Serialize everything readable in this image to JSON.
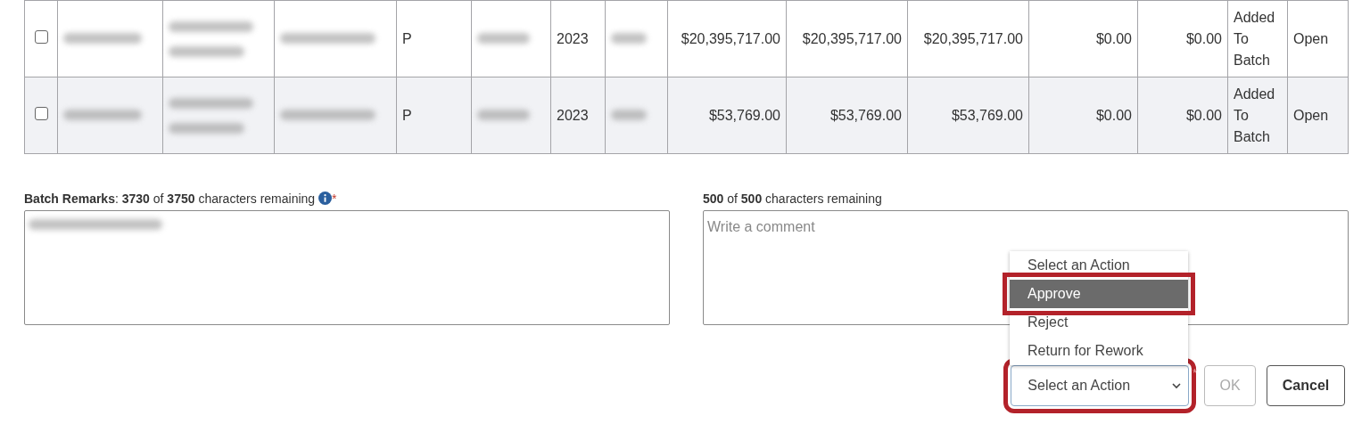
{
  "table": {
    "rows": [
      {
        "checked": false,
        "selected": false,
        "cells": [
          {
            "kind": "redacted"
          },
          {
            "kind": "redacted-wrapped"
          },
          {
            "kind": "redacted"
          },
          {
            "kind": "text",
            "text": "P"
          },
          {
            "kind": "redacted"
          },
          {
            "kind": "text",
            "text": "2023"
          },
          {
            "kind": "redacted"
          },
          {
            "kind": "money",
            "text": "$20,395,717.00"
          },
          {
            "kind": "money",
            "text": "$20,395,717.00"
          },
          {
            "kind": "money",
            "text": "$20,395,717.00"
          },
          {
            "kind": "money",
            "text": "$0.00"
          },
          {
            "kind": "money",
            "text": "$0.00"
          },
          {
            "kind": "text",
            "text": "Added To Batch"
          },
          {
            "kind": "text",
            "text": "Open"
          }
        ]
      },
      {
        "checked": false,
        "selected": true,
        "cells": [
          {
            "kind": "redacted"
          },
          {
            "kind": "redacted-wrapped"
          },
          {
            "kind": "redacted"
          },
          {
            "kind": "text",
            "text": "P"
          },
          {
            "kind": "redacted"
          },
          {
            "kind": "text",
            "text": "2023"
          },
          {
            "kind": "redacted"
          },
          {
            "kind": "money",
            "text": "$53,769.00"
          },
          {
            "kind": "money",
            "text": "$53,769.00"
          },
          {
            "kind": "money",
            "text": "$53,769.00"
          },
          {
            "kind": "money",
            "text": "$0.00"
          },
          {
            "kind": "money",
            "text": "$0.00"
          },
          {
            "kind": "text",
            "text": "Added To Batch"
          },
          {
            "kind": "text",
            "text": "Open"
          }
        ]
      }
    ]
  },
  "batch_remarks": {
    "label": "**Batch Remarks**: **3730** of **3750** characters remaining",
    "required_mark": "*",
    "value_redacted": true
  },
  "comment": {
    "label": "**500** of **500** characters remaining",
    "placeholder": "Write a comment"
  },
  "action_menu": {
    "expanded": true,
    "options": [
      {
        "label": "Select an Action",
        "selected": false,
        "highlighted": false
      },
      {
        "label": "Approve",
        "selected": true,
        "highlighted": true
      },
      {
        "label": "Reject",
        "selected": false,
        "highlighted": false
      },
      {
        "label": "Return for Rework",
        "selected": false,
        "highlighted": false
      }
    ]
  },
  "action_select": {
    "value": "Select an Action",
    "required_mark": "*",
    "highlighted": true
  },
  "buttons": [
    {
      "label": "OK",
      "disabled": true
    },
    {
      "label": "Cancel",
      "disabled": false
    }
  ]
}
